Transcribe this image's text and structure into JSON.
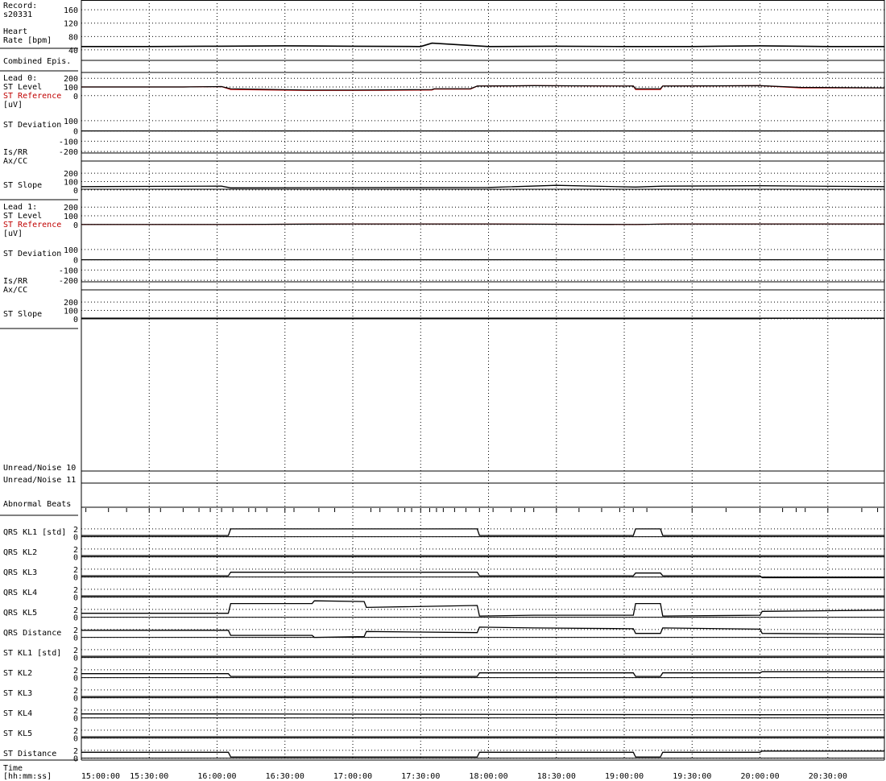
{
  "chart_data": {
    "type": "line",
    "record": "s20331",
    "x_axis": {
      "label_line1": "Time",
      "label_line2": "[hh:mm:ss]",
      "ticks": [
        "15:00:00",
        "15:30:00",
        "16:00:00",
        "16:30:00",
        "17:00:00",
        "17:30:00",
        "18:00:00",
        "18:30:00",
        "19:00:00",
        "19:30:00",
        "20:00:00",
        "20:30:00"
      ],
      "tick_minutes": [
        0,
        30,
        60,
        90,
        120,
        150,
        180,
        210,
        240,
        270,
        300,
        330
      ],
      "range_minutes": [
        0,
        355
      ]
    },
    "heart_rate": {
      "label_lines": [
        "Record:",
        "s20331",
        "Heart",
        "Rate [bpm]"
      ],
      "ticks": [
        "160",
        "120",
        "80",
        "40"
      ],
      "tick_values": [
        160,
        120,
        80,
        40
      ],
      "ylim": [
        35,
        170
      ],
      "x": [
        0,
        30,
        60,
        90,
        120,
        150,
        155,
        180,
        210,
        240,
        270,
        300,
        330,
        355
      ],
      "y": [
        50,
        50,
        51,
        52,
        51,
        50,
        60,
        50,
        51,
        50,
        50,
        52,
        50,
        50
      ]
    },
    "combined_episodes": {
      "label": "Combined Epis."
    },
    "lead0": {
      "title": "Lead 0:",
      "level_label": "ST Level",
      "reference_label": "ST Reference",
      "unit_label": "[uV]",
      "level_ticks": [
        "200",
        "100",
        "0"
      ],
      "level_tick_values": [
        200,
        100,
        0
      ],
      "level_ylim": [
        -30,
        230
      ],
      "level_x": [
        0,
        45,
        62,
        66,
        100,
        120,
        155,
        156,
        172,
        175,
        200,
        244,
        245,
        256,
        257,
        300,
        318,
        355
      ],
      "level": [
        100,
        100,
        105,
        80,
        65,
        65,
        70,
        80,
        80,
        110,
        115,
        110,
        80,
        80,
        110,
        115,
        95,
        90
      ],
      "reference": [
        100,
        100,
        105,
        70,
        60,
        60,
        65,
        75,
        75,
        110,
        115,
        110,
        70,
        70,
        110,
        115,
        90,
        90
      ],
      "deviation_label": "ST Deviation",
      "deviation_ticks": [
        "100",
        "0",
        "-100",
        "-200"
      ],
      "deviation_tick_values": [
        100,
        0,
        -100,
        -200
      ],
      "deviation_ylim": [
        -230,
        130
      ],
      "deviation_x": [
        0,
        60,
        62,
        100,
        155,
        156,
        200,
        230,
        300,
        355
      ],
      "deviation": [
        0,
        0,
        0,
        0,
        0,
        0,
        0,
        0,
        0,
        0
      ],
      "isrr_label": "Is/RR",
      "axcc_label": "Ax/CC",
      "slope_label": "ST Slope",
      "slope_ticks": [
        "200",
        "100",
        "0"
      ],
      "slope_tick_values": [
        200,
        100,
        0
      ],
      "slope_ylim": [
        -20,
        230
      ],
      "slope_x": [
        0,
        62,
        66,
        180,
        210,
        245,
        257,
        300,
        355
      ],
      "slope": [
        40,
        45,
        25,
        30,
        55,
        35,
        45,
        50,
        40
      ]
    },
    "lead1": {
      "title": "Lead 1:",
      "level_label": "ST Level",
      "reference_label": "ST Reference",
      "unit_label": "[uV]",
      "level_ticks": [
        "200",
        "100",
        "0"
      ],
      "level_tick_values": [
        200,
        100,
        0
      ],
      "level_ylim": [
        -30,
        230
      ],
      "level_x": [
        0,
        62,
        120,
        180,
        245,
        260,
        300,
        355
      ],
      "level": [
        0,
        0,
        5,
        5,
        0,
        5,
        5,
        5
      ],
      "reference": [
        0,
        0,
        5,
        5,
        0,
        5,
        5,
        5
      ],
      "deviation_label": "ST Deviation",
      "deviation_ticks": [
        "100",
        "0",
        "-100",
        "-200"
      ],
      "deviation_tick_values": [
        100,
        0,
        -100,
        -200
      ],
      "deviation_ylim": [
        -230,
        130
      ],
      "deviation_x": [
        0,
        62,
        120,
        200,
        300,
        355
      ],
      "deviation": [
        0,
        0,
        0,
        0,
        0,
        0
      ],
      "isrr_label": "Is/RR",
      "axcc_label": "Ax/CC",
      "slope_label": "ST Slope",
      "slope_ticks": [
        "200",
        "100",
        "0"
      ],
      "slope_tick_values": [
        200,
        100,
        0
      ],
      "slope_ylim": [
        -20,
        230
      ],
      "slope_x": [
        0,
        300,
        301,
        355
      ],
      "slope": [
        0,
        0,
        5,
        5
      ]
    },
    "unread_noise": [
      "Unread/Noise 10",
      "Unread/Noise 11"
    ],
    "abnormal_beats": {
      "label": "Abnormal Beats",
      "x": [
        2,
        12,
        20,
        30,
        35,
        45,
        52,
        57,
        62,
        67,
        74,
        77,
        82,
        90,
        94,
        105,
        112,
        128,
        132,
        140,
        143,
        146,
        150,
        154,
        157,
        160,
        165,
        170,
        176,
        182,
        190,
        196,
        200,
        210,
        220,
        230,
        238,
        244,
        250,
        270,
        285,
        300,
        310,
        316,
        320,
        330,
        345,
        352
      ]
    },
    "qrs_kl": [
      {
        "name": "QRS KL1 [std]",
        "x": [
          0,
          65,
          66,
          175,
          176,
          244,
          245,
          256,
          257,
          300,
          301,
          355
        ],
        "y": [
          0.3,
          0.3,
          2,
          2,
          0.3,
          0.3,
          2,
          2,
          0.3,
          0.3,
          0.3,
          0.3
        ]
      },
      {
        "name": "QRS KL2",
        "x": [
          0,
          60,
          300,
          355
        ],
        "y": [
          0.3,
          0.3,
          0.3,
          0.3
        ]
      },
      {
        "name": "QRS KL3",
        "x": [
          0,
          65,
          66,
          175,
          176,
          244,
          245,
          256,
          257,
          300,
          301,
          355
        ],
        "y": [
          0.3,
          0.3,
          1.2,
          1.2,
          0.3,
          0.3,
          1.0,
          1.0,
          0.3,
          0.3,
          -0.2,
          -0.2
        ]
      },
      {
        "name": "QRS KL4",
        "x": [
          0,
          60,
          300,
          355
        ],
        "y": [
          0.3,
          0.3,
          0.3,
          0.3
        ]
      },
      {
        "name": "QRS KL5",
        "x": [
          0,
          60,
          65,
          66,
          102,
          103,
          125,
          126,
          175,
          176,
          200,
          244,
          245,
          256,
          257,
          300,
          301,
          355
        ],
        "y": [
          1.0,
          1.0,
          1.0,
          3.5,
          3.5,
          4.2,
          4.0,
          2.5,
          3.0,
          0.3,
          0.5,
          0.5,
          3.5,
          3.5,
          0.3,
          0.5,
          1.5,
          1.8
        ]
      },
      {
        "name": "QRS Distance",
        "x": [
          0,
          60,
          65,
          66,
          102,
          103,
          125,
          126,
          175,
          176,
          200,
          244,
          245,
          256,
          257,
          300,
          301,
          355
        ],
        "y": [
          1.8,
          1.8,
          1.8,
          0.5,
          0.5,
          0.0,
          0.2,
          1.5,
          1.2,
          2.6,
          2.4,
          2.2,
          1.0,
          1.0,
          2.4,
          2.1,
          1.0,
          0.8
        ]
      }
    ],
    "st_kl": [
      {
        "name": "ST KL1 [std]",
        "x": [
          0,
          60,
          300,
          355
        ],
        "y": [
          0.3,
          0.3,
          0.3,
          0.3
        ]
      },
      {
        "name": "ST KL2",
        "x": [
          0,
          65,
          66,
          175,
          176,
          244,
          245,
          256,
          257,
          300,
          301,
          355
        ],
        "y": [
          1.0,
          1.0,
          0.3,
          0.3,
          1.2,
          1.2,
          0.3,
          0.3,
          1.2,
          1.2,
          1.5,
          1.5
        ]
      },
      {
        "name": "ST KL3",
        "x": [
          0,
          60,
          300,
          355
        ],
        "y": [
          0.3,
          0.3,
          0.3,
          0.3
        ]
      },
      {
        "name": "ST KL4",
        "x": [
          0,
          60,
          300,
          355
        ],
        "y": [
          1.0,
          1.0,
          0.8,
          0.8
        ]
      },
      {
        "name": "ST KL5",
        "x": [
          0,
          60,
          300,
          355
        ],
        "y": [
          0.3,
          0.3,
          0.3,
          0.3
        ]
      },
      {
        "name": "ST Distance",
        "x": [
          0,
          65,
          66,
          175,
          176,
          244,
          245,
          256,
          257,
          300,
          301,
          355
        ],
        "y": [
          1.5,
          1.5,
          0.3,
          0.3,
          1.5,
          1.5,
          0.3,
          0.3,
          1.5,
          1.5,
          1.8,
          1.8
        ]
      }
    ],
    "kl_ticks": [
      "2",
      "0"
    ],
    "kl_tick_values": [
      2,
      0
    ],
    "kl_ylim": [
      -0.5,
      3
    ]
  },
  "colors": {
    "trace": "#000000",
    "reference": "#cc0000",
    "grid": "#000000",
    "background": "#ffffff"
  }
}
